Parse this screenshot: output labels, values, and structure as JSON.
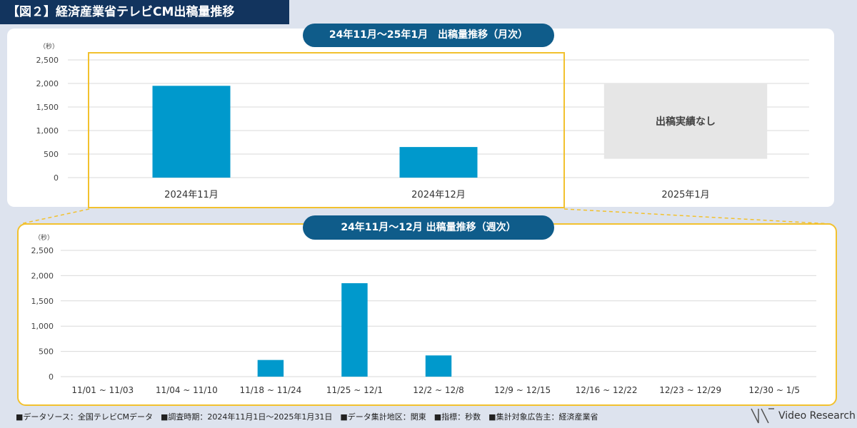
{
  "figure_title": "【図２】経済産業省テレビCM出稿量推移",
  "footer": {
    "text": "■データソース：全国テレビCMデータ　■調査時期：2024年11月1日～2025年1月31日　■データ集計地区：関東　■指標：秒数　■集計対象広告主：経済産業省",
    "brand": "Video Research"
  },
  "colors": {
    "bar": "#0099cc",
    "header": "#12345e",
    "pill": "#0f5c8a",
    "highlight": "#f2c12e",
    "no_data_box": "#e6e6e6"
  },
  "chart_data": [
    {
      "type": "bar",
      "title": "24年11月～25年1月　出稿量推移（月次）",
      "ylabel": "（秒）",
      "ylim": [
        0,
        2500
      ],
      "yticks": [
        "0",
        "500",
        "1,000",
        "1,500",
        "2,000",
        "2,500"
      ],
      "categories": [
        "2024年11月",
        "2024年12月",
        "2025年1月"
      ],
      "values": [
        1950,
        650,
        null
      ],
      "annotation": "出稿実績なし",
      "grid": true
    },
    {
      "type": "bar",
      "title": "24年11月～12月 出稿量推移（週次）",
      "ylabel": "（秒）",
      "ylim": [
        0,
        2500
      ],
      "yticks": [
        "0",
        "500",
        "1,000",
        "1,500",
        "2,000",
        "2,500"
      ],
      "categories": [
        "11/01 ~ 11/03",
        "11/04 ~ 11/10",
        "11/18 ~ 11/24",
        "11/25 ~ 12/1",
        "12/2 ~ 12/8",
        "12/9 ~ 12/15",
        "12/16 ~ 12/22",
        "12/23 ~ 12/29",
        "12/30 ~ 1/5"
      ],
      "values": [
        0,
        0,
        330,
        1850,
        420,
        0,
        0,
        0,
        0
      ],
      "grid": true
    }
  ]
}
